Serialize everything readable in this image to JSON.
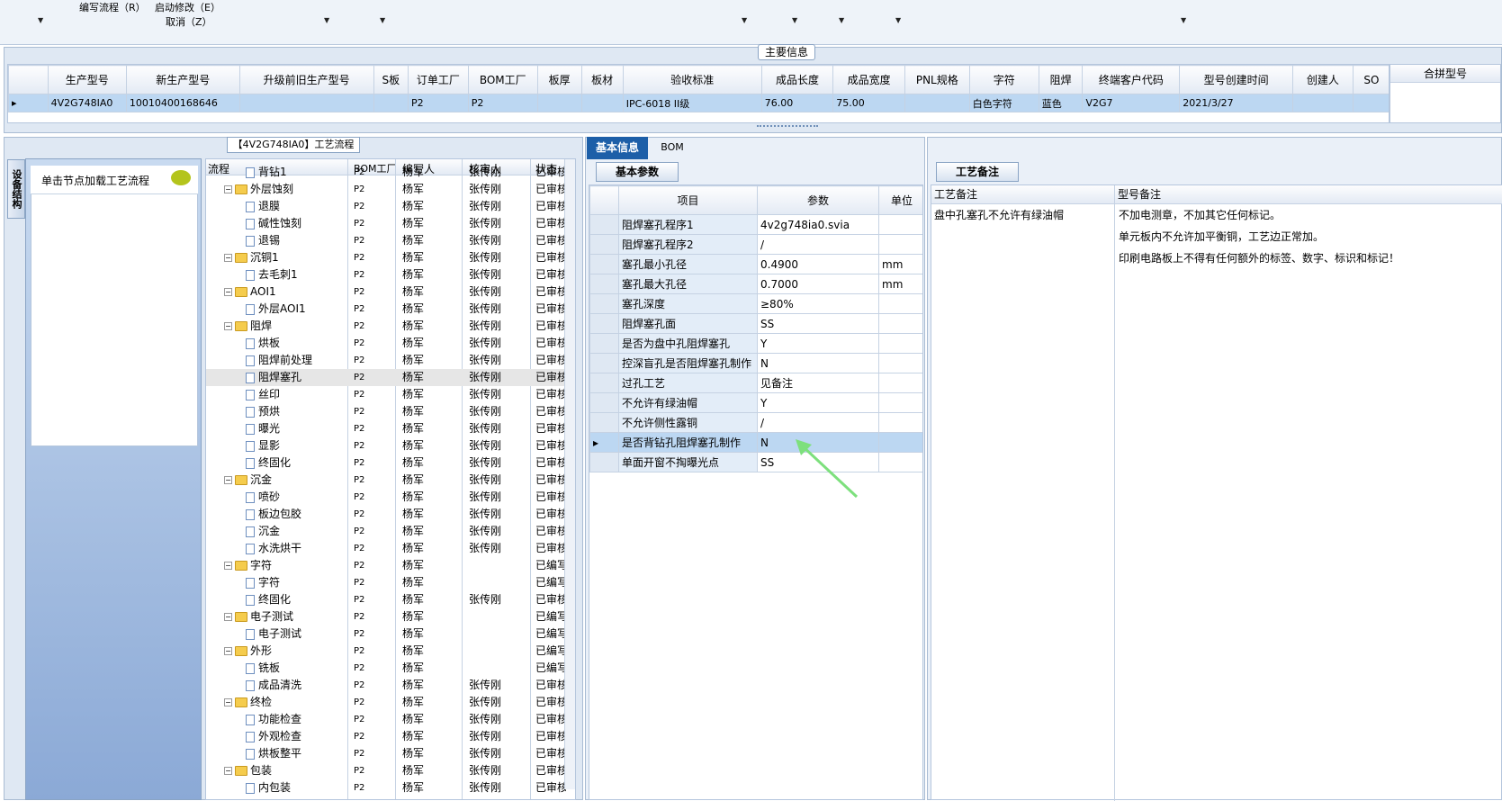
{
  "toolbar": {
    "menu1": "编写流程（R）",
    "menu2": "启动修改（E）",
    "menu3": "取消（Z）"
  },
  "main_info": {
    "label": "主要信息",
    "columns": [
      "生产型号",
      "新生产型号",
      "升级前旧生产型号",
      "S板",
      "订单工厂",
      "BOM工厂",
      "板厚",
      "板材",
      "验收标准",
      "成品长度",
      "成品宽度",
      "PNL规格",
      "字符",
      "阻焊",
      "终端客户代码",
      "型号创建时间",
      "创建人",
      "SO"
    ],
    "row": [
      "4V2G748IA0",
      "10010400168646",
      "",
      "",
      "P2",
      "P2",
      "",
      "",
      "IPC-6018 II级",
      "76.00",
      "75.00",
      "",
      "白色字符",
      "蓝色",
      "V2G7",
      "2021/3/27",
      "",
      ""
    ],
    "right_header": "合拼型号"
  },
  "left": {
    "title": "【4V2G748IA0】工艺流程",
    "vertical_tab": "设备结构",
    "load_hint": "单击节点加载工艺流程",
    "tree_columns": [
      "流程",
      "BOM工厂",
      "编写人",
      "核审人",
      "状态"
    ],
    "rows": [
      {
        "lvl": 2,
        "type": "doc",
        "name": "背钻1",
        "bom": "P2",
        "writer": "杨军",
        "reviewer": "张传刚",
        "status": "已审核"
      },
      {
        "lvl": 1,
        "type": "folder",
        "name": "外层蚀刻",
        "bom": "P2",
        "writer": "杨军",
        "reviewer": "张传刚",
        "status": "已审核"
      },
      {
        "lvl": 2,
        "type": "doc",
        "name": "退膜",
        "bom": "P2",
        "writer": "杨军",
        "reviewer": "张传刚",
        "status": "已审核"
      },
      {
        "lvl": 2,
        "type": "doc",
        "name": "碱性蚀刻",
        "bom": "P2",
        "writer": "杨军",
        "reviewer": "张传刚",
        "status": "已审核"
      },
      {
        "lvl": 2,
        "type": "doc",
        "name": "退锡",
        "bom": "P2",
        "writer": "杨军",
        "reviewer": "张传刚",
        "status": "已审核"
      },
      {
        "lvl": 1,
        "type": "folder",
        "name": "沉铜1",
        "bom": "P2",
        "writer": "杨军",
        "reviewer": "张传刚",
        "status": "已审核"
      },
      {
        "lvl": 2,
        "type": "doc",
        "name": "去毛刺1",
        "bom": "P2",
        "writer": "杨军",
        "reviewer": "张传刚",
        "status": "已审核"
      },
      {
        "lvl": 1,
        "type": "folder",
        "name": "AOI1",
        "bom": "P2",
        "writer": "杨军",
        "reviewer": "张传刚",
        "status": "已审核"
      },
      {
        "lvl": 2,
        "type": "doc",
        "name": "外层AOI1",
        "bom": "P2",
        "writer": "杨军",
        "reviewer": "张传刚",
        "status": "已审核"
      },
      {
        "lvl": 1,
        "type": "folder",
        "name": "阻焊",
        "bom": "P2",
        "writer": "杨军",
        "reviewer": "张传刚",
        "status": "已审核"
      },
      {
        "lvl": 2,
        "type": "doc",
        "name": "烘板",
        "bom": "P2",
        "writer": "杨军",
        "reviewer": "张传刚",
        "status": "已审核"
      },
      {
        "lvl": 2,
        "type": "doc",
        "name": "阻焊前处理",
        "bom": "P2",
        "writer": "杨军",
        "reviewer": "张传刚",
        "status": "已审核"
      },
      {
        "lvl": 2,
        "type": "doc",
        "name": "阻焊塞孔",
        "bom": "P2",
        "writer": "杨军",
        "reviewer": "张传刚",
        "status": "已审核",
        "selected": true
      },
      {
        "lvl": 2,
        "type": "doc",
        "name": "丝印",
        "bom": "P2",
        "writer": "杨军",
        "reviewer": "张传刚",
        "status": "已审核"
      },
      {
        "lvl": 2,
        "type": "doc",
        "name": "预烘",
        "bom": "P2",
        "writer": "杨军",
        "reviewer": "张传刚",
        "status": "已审核"
      },
      {
        "lvl": 2,
        "type": "doc",
        "name": "曝光",
        "bom": "P2",
        "writer": "杨军",
        "reviewer": "张传刚",
        "status": "已审核"
      },
      {
        "lvl": 2,
        "type": "doc",
        "name": "显影",
        "bom": "P2",
        "writer": "杨军",
        "reviewer": "张传刚",
        "status": "已审核"
      },
      {
        "lvl": 2,
        "type": "doc",
        "name": "终固化",
        "bom": "P2",
        "writer": "杨军",
        "reviewer": "张传刚",
        "status": "已审核"
      },
      {
        "lvl": 1,
        "type": "folder",
        "name": "沉金",
        "bom": "P2",
        "writer": "杨军",
        "reviewer": "张传刚",
        "status": "已审核"
      },
      {
        "lvl": 2,
        "type": "doc",
        "name": "喷砂",
        "bom": "P2",
        "writer": "杨军",
        "reviewer": "张传刚",
        "status": "已审核"
      },
      {
        "lvl": 2,
        "type": "doc",
        "name": "板边包胶",
        "bom": "P2",
        "writer": "杨军",
        "reviewer": "张传刚",
        "status": "已审核"
      },
      {
        "lvl": 2,
        "type": "doc",
        "name": "沉金",
        "bom": "P2",
        "writer": "杨军",
        "reviewer": "张传刚",
        "status": "已审核"
      },
      {
        "lvl": 2,
        "type": "doc",
        "name": "水洗烘干",
        "bom": "P2",
        "writer": "杨军",
        "reviewer": "张传刚",
        "status": "已审核"
      },
      {
        "lvl": 1,
        "type": "folder",
        "name": "字符",
        "bom": "P2",
        "writer": "杨军",
        "reviewer": "",
        "status": "已编写"
      },
      {
        "lvl": 2,
        "type": "doc",
        "name": "字符",
        "bom": "P2",
        "writer": "杨军",
        "reviewer": "",
        "status": "已编写"
      },
      {
        "lvl": 2,
        "type": "doc",
        "name": "终固化",
        "bom": "P2",
        "writer": "杨军",
        "reviewer": "张传刚",
        "status": "已审核"
      },
      {
        "lvl": 1,
        "type": "folder",
        "name": "电子测试",
        "bom": "P2",
        "writer": "杨军",
        "reviewer": "",
        "status": "已编写"
      },
      {
        "lvl": 2,
        "type": "doc",
        "name": "电子测试",
        "bom": "P2",
        "writer": "杨军",
        "reviewer": "",
        "status": "已编写"
      },
      {
        "lvl": 1,
        "type": "folder",
        "name": "外形",
        "bom": "P2",
        "writer": "杨军",
        "reviewer": "",
        "status": "已编写"
      },
      {
        "lvl": 2,
        "type": "doc",
        "name": "铣板",
        "bom": "P2",
        "writer": "杨军",
        "reviewer": "",
        "status": "已编写"
      },
      {
        "lvl": 2,
        "type": "doc",
        "name": "成品清洗",
        "bom": "P2",
        "writer": "杨军",
        "reviewer": "张传刚",
        "status": "已审核"
      },
      {
        "lvl": 1,
        "type": "folder",
        "name": "终检",
        "bom": "P2",
        "writer": "杨军",
        "reviewer": "张传刚",
        "status": "已审核"
      },
      {
        "lvl": 2,
        "type": "doc",
        "name": "功能检查",
        "bom": "P2",
        "writer": "杨军",
        "reviewer": "张传刚",
        "status": "已审核"
      },
      {
        "lvl": 2,
        "type": "doc",
        "name": "外观检查",
        "bom": "P2",
        "writer": "杨军",
        "reviewer": "张传刚",
        "status": "已审核"
      },
      {
        "lvl": 2,
        "type": "doc",
        "name": "烘板整平",
        "bom": "P2",
        "writer": "杨军",
        "reviewer": "张传刚",
        "status": "已审核"
      },
      {
        "lvl": 1,
        "type": "folder",
        "name": "包装",
        "bom": "P2",
        "writer": "杨军",
        "reviewer": "张传刚",
        "status": "已审核"
      },
      {
        "lvl": 2,
        "type": "doc",
        "name": "内包装",
        "bom": "P2",
        "writer": "杨军",
        "reviewer": "张传刚",
        "status": "已审核"
      }
    ]
  },
  "middle": {
    "tab_basic": "基本信息",
    "tab_bom": "BOM",
    "subtab": "基本参数",
    "columns": [
      "项目",
      "参数",
      "单位"
    ],
    "rows": [
      {
        "item": "阻焊塞孔程序1",
        "value": "4v2g748ia0.svia",
        "unit": ""
      },
      {
        "item": "阻焊塞孔程序2",
        "value": "/",
        "unit": ""
      },
      {
        "item": "塞孔最小孔径",
        "value": "0.4900",
        "unit": "mm"
      },
      {
        "item": "塞孔最大孔径",
        "value": "0.7000",
        "unit": "mm"
      },
      {
        "item": "塞孔深度",
        "value": "≥80%",
        "unit": ""
      },
      {
        "item": "阻焊塞孔面",
        "value": "SS",
        "unit": ""
      },
      {
        "item": "是否为盘中孔阻焊塞孔",
        "value": "Y",
        "unit": ""
      },
      {
        "item": "控深盲孔是否阻焊塞孔制作",
        "value": "N",
        "unit": ""
      },
      {
        "item": "过孔工艺",
        "value": "见备注",
        "unit": ""
      },
      {
        "item": "不允许有绿油帽",
        "value": "Y",
        "unit": ""
      },
      {
        "item": "不允许侧性露铜",
        "value": "/",
        "unit": ""
      },
      {
        "item": "是否背钻孔阻焊塞孔制作",
        "value": "N",
        "unit": "",
        "selected": true
      },
      {
        "item": "单面开窗不掏曝光点",
        "value": "SS",
        "unit": ""
      }
    ]
  },
  "right": {
    "subtab": "工艺备注",
    "col1": "工艺备注",
    "col2": "型号备注",
    "process_note": "盘中孔塞孔不允许有绿油帽",
    "model_notes": [
      "不加电测章，不加其它任何标记。",
      "单元板内不允许加平衡铜，工艺边正常加。",
      "印刷电路板上不得有任何额外的标签、数字、标识和标记！"
    ]
  }
}
